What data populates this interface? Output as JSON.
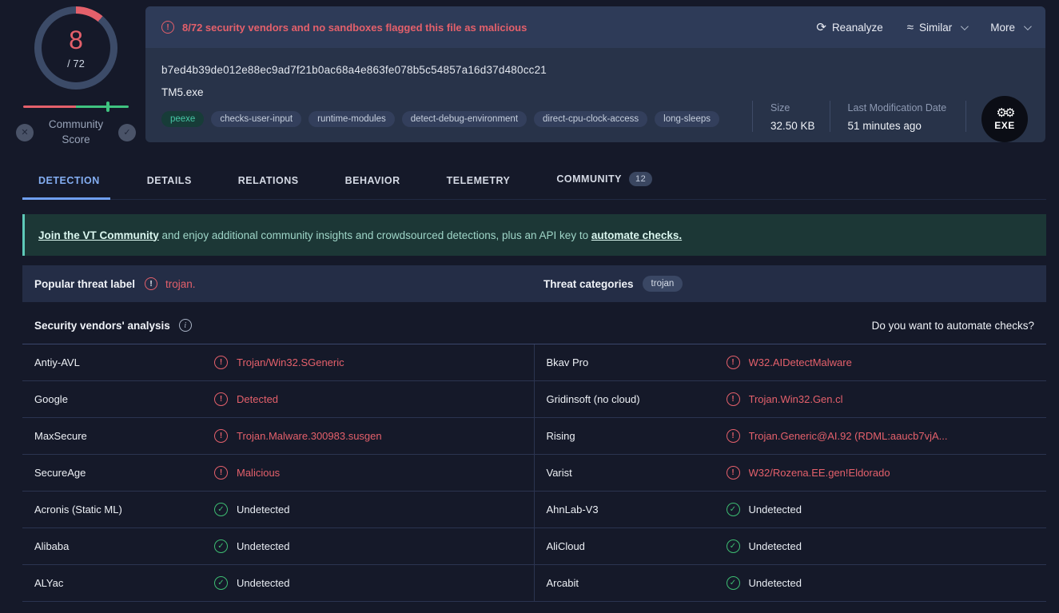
{
  "score_widget": {
    "score": "8",
    "total": "/ 72",
    "community_label": "Community Score",
    "x_glyph": "✕",
    "check_glyph": "✓",
    "accent_red": "#e4606b",
    "accent_green": "#3fc380"
  },
  "header": {
    "warning_icon": "!",
    "warning": "8/72 security vendors and no sandboxes flagged this file as malicious",
    "actions": {
      "reanalyze_icon": "⟳",
      "reanalyze": "Reanalyze",
      "similar_icon": "≈",
      "similar": "Similar",
      "more": "More"
    },
    "hash": "b7ed4b39de012e88ec9ad7f21b0ac68a4e863fe078b5c54857a16d37d480cc21",
    "filename": "TM5.exe",
    "tags": [
      "peexe",
      "checks-user-input",
      "runtime-modules",
      "detect-debug-environment",
      "direct-cpu-clock-access",
      "long-sleeps"
    ],
    "size_label": "Size",
    "size_value": "32.50 KB",
    "modified_label": "Last Modification Date",
    "modified_value": "51 minutes ago",
    "file_type_badge": "EXE",
    "exe_gears": "⚙⚙"
  },
  "tabs": {
    "detection": "DETECTION",
    "details": "DETAILS",
    "relations": "RELATIONS",
    "behavior": "BEHAVIOR",
    "telemetry": "TELEMETRY",
    "community": "COMMUNITY",
    "community_badge": "12"
  },
  "community_banner": {
    "link1": "Join the VT Community",
    "middle": " and enjoy additional community insights and crowdsourced detections, plus an API key to ",
    "link2": "automate checks."
  },
  "threat_row": {
    "label": "Popular threat label",
    "warning_icon": "!",
    "value": "trojan.",
    "categories_label": "Threat categories",
    "category_pill": "trojan"
  },
  "analysis": {
    "title": "Security vendors' analysis",
    "info_icon": "i",
    "automate": "Do you want to automate checks?"
  },
  "vendors": [
    {
      "name": "Antiy-AVL",
      "result": "Trojan/Win32.SGeneric",
      "status": "malicious"
    },
    {
      "name": "Bkav Pro",
      "result": "W32.AIDetectMalware",
      "status": "malicious"
    },
    {
      "name": "Google",
      "result": "Detected",
      "status": "malicious"
    },
    {
      "name": "Gridinsoft (no cloud)",
      "result": "Trojan.Win32.Gen.cl",
      "status": "malicious"
    },
    {
      "name": "MaxSecure",
      "result": "Trojan.Malware.300983.susgen",
      "status": "malicious"
    },
    {
      "name": "Rising",
      "result": "Trojan.Generic@AI.92 (RDML:aaucb7vjA...",
      "status": "malicious"
    },
    {
      "name": "SecureAge",
      "result": "Malicious",
      "status": "malicious"
    },
    {
      "name": "Varist",
      "result": "W32/Rozena.EE.gen!Eldorado",
      "status": "malicious"
    },
    {
      "name": "Acronis (Static ML)",
      "result": "Undetected",
      "status": "clean"
    },
    {
      "name": "AhnLab-V3",
      "result": "Undetected",
      "status": "clean"
    },
    {
      "name": "Alibaba",
      "result": "Undetected",
      "status": "clean"
    },
    {
      "name": "AliCloud",
      "result": "Undetected",
      "status": "clean"
    },
    {
      "name": "ALYac",
      "result": "Undetected",
      "status": "clean"
    },
    {
      "name": "Arcabit",
      "result": "Undetected",
      "status": "clean"
    }
  ]
}
